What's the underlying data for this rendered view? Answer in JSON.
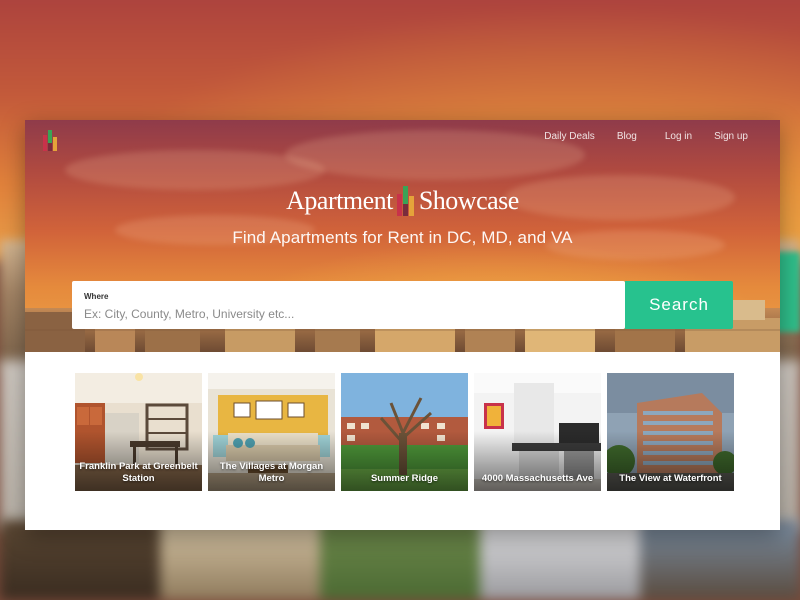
{
  "brand": {
    "name_part1": "Apartment",
    "name_part2": "Showcase",
    "tagline": "Find Apartments for Rent in DC, MD, and VA"
  },
  "nav": {
    "items": [
      "Daily Deals",
      "Blog",
      "Log in",
      "Sign up"
    ]
  },
  "search": {
    "label": "Where",
    "placeholder": "Ex: City, County, Metro, University etc...",
    "value": "",
    "button_label": "Search"
  },
  "listings": [
    {
      "name": "Franklin Park at Greenbelt Station"
    },
    {
      "name": "The Villages at Morgan Metro"
    },
    {
      "name": "Summer Ridge"
    },
    {
      "name": "4000 Massachusetts Ave"
    },
    {
      "name": "The View at Waterfront"
    }
  ],
  "colors": {
    "accent": "#27c28e",
    "logo_red": "#c8324a",
    "logo_green": "#3aa356",
    "logo_gold": "#e5a33a"
  }
}
